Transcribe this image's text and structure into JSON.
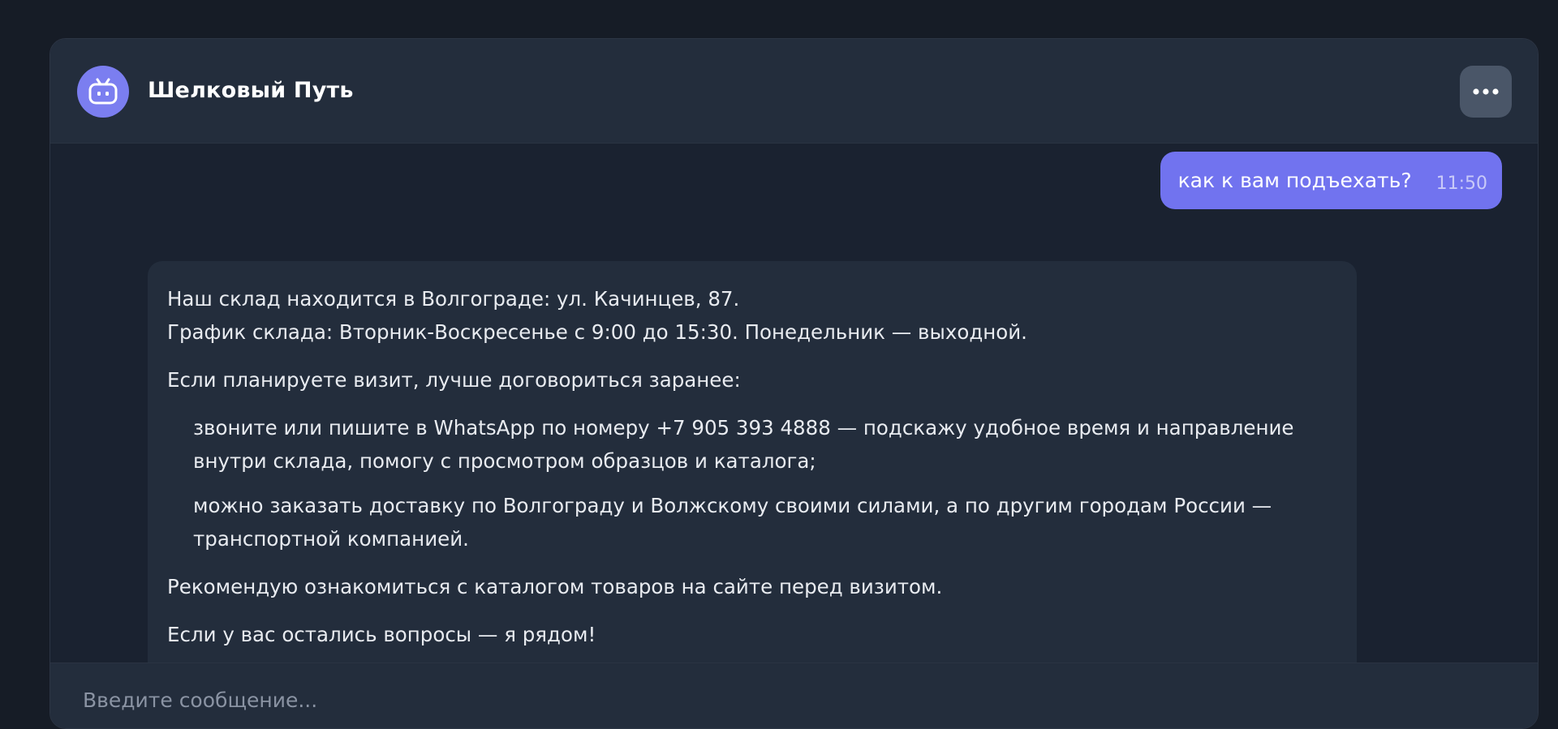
{
  "header": {
    "title": "Шелковый Путь",
    "avatar_icon": "robot-tv-icon",
    "menu_icon": "more-horizontal-icon"
  },
  "messages": {
    "user": {
      "text": "как к вам подъехать?",
      "time": "11:50"
    },
    "bot": {
      "p1_line1": "Наш склад находится в Волгограде: ул. Качинцев, 87.",
      "p1_line2": "График склада: Вторник-Воскресенье с 9:00 до 15:30. Понедельник — выходной.",
      "p2": "Если планируете визит, лучше договориться заранее:",
      "list": [
        "звоните или пишите в WhatsApp по номеру +7 905 393 4888 — подскажу удобное время и направление внутри склада, помогу с просмотром образцов и каталога;",
        "можно заказать доставку по Волгограду и Волжскому своими силами, а по другим городам России — транспортной компанией."
      ],
      "p3": "Рекомендую ознакомиться с каталогом товаров на сайте перед визитом.",
      "p4": "Если у вас остались вопросы — я рядом!"
    }
  },
  "composer": {
    "placeholder": "Введите сообщение..."
  },
  "colors": {
    "accent": "#7173ef",
    "avatar": "#7b7ef0",
    "background": "#161c26",
    "panel": "#232d3c"
  }
}
